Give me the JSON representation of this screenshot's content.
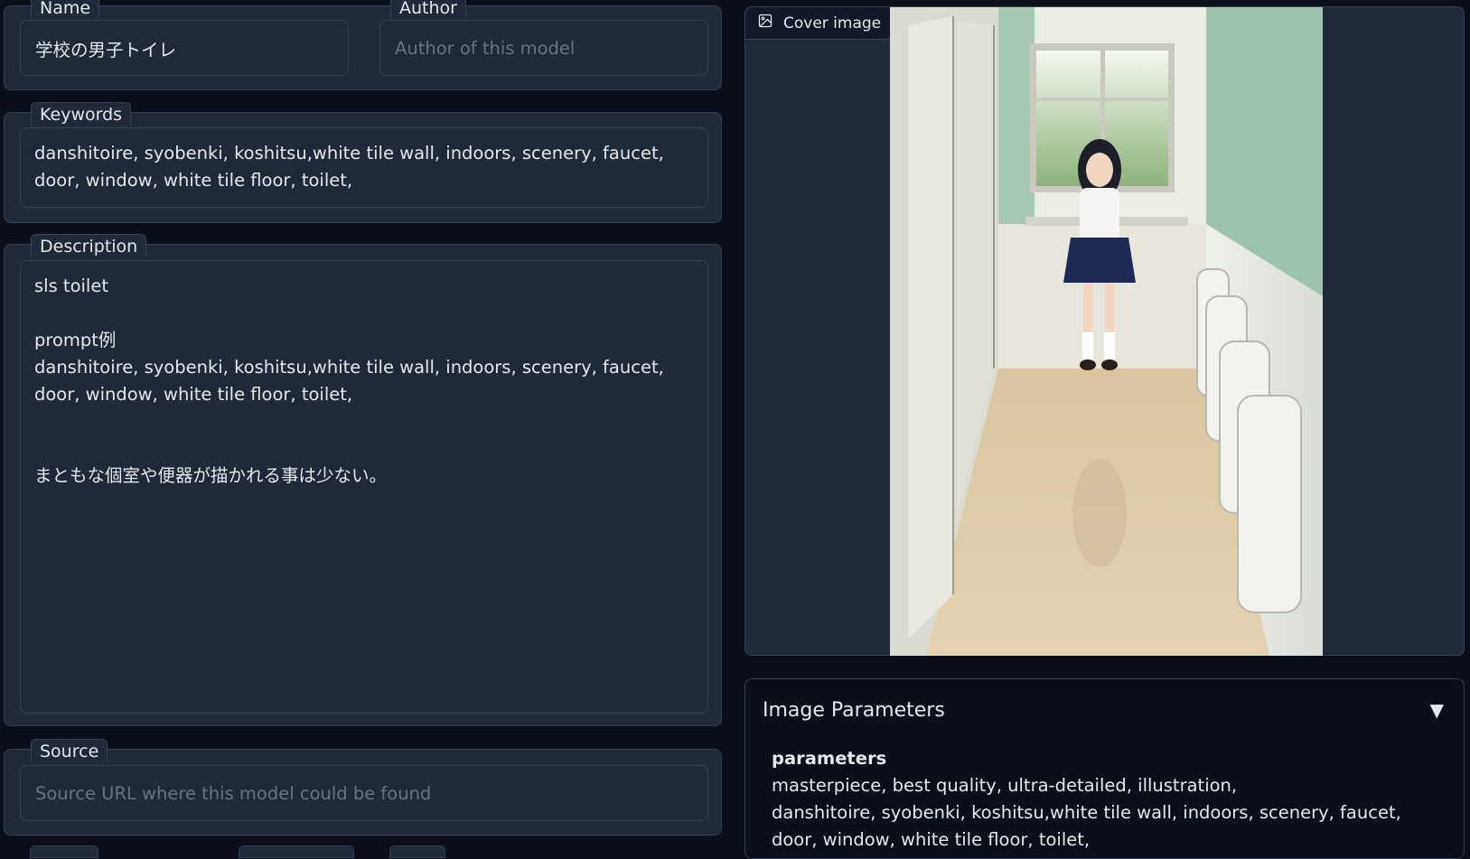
{
  "left": {
    "name": {
      "label": "Name",
      "value": "学校の男子トイレ"
    },
    "author": {
      "label": "Author",
      "placeholder": "Author of this model"
    },
    "keywords": {
      "label": "Keywords",
      "value": "danshitoire, syobenki, koshitsu,white tile wall, indoors, scenery, faucet, door, window, white tile floor, toilet,"
    },
    "description": {
      "label": "Description",
      "value": "sls toilet\n\nprompt例\ndanshitoire, syobenki, koshitsu,white tile wall, indoors, scenery, faucet, door, window, white tile floor, toilet,\n\n\nまともな個室や便器が描かれる事は少ない。"
    },
    "source": {
      "label": "Source",
      "placeholder": "Source URL where this model could be found"
    }
  },
  "right": {
    "cover": {
      "label": "Cover image",
      "icon": "image-icon"
    },
    "params": {
      "title": "Image Parameters",
      "toggle_glyph": "▼",
      "key": "parameters",
      "text": "masterpiece, best quality, ultra-detailed, illustration,\ndanshitoire, syobenki, koshitsu,white tile wall, indoors, scenery, faucet, door, window, white tile floor, toilet,"
    }
  }
}
